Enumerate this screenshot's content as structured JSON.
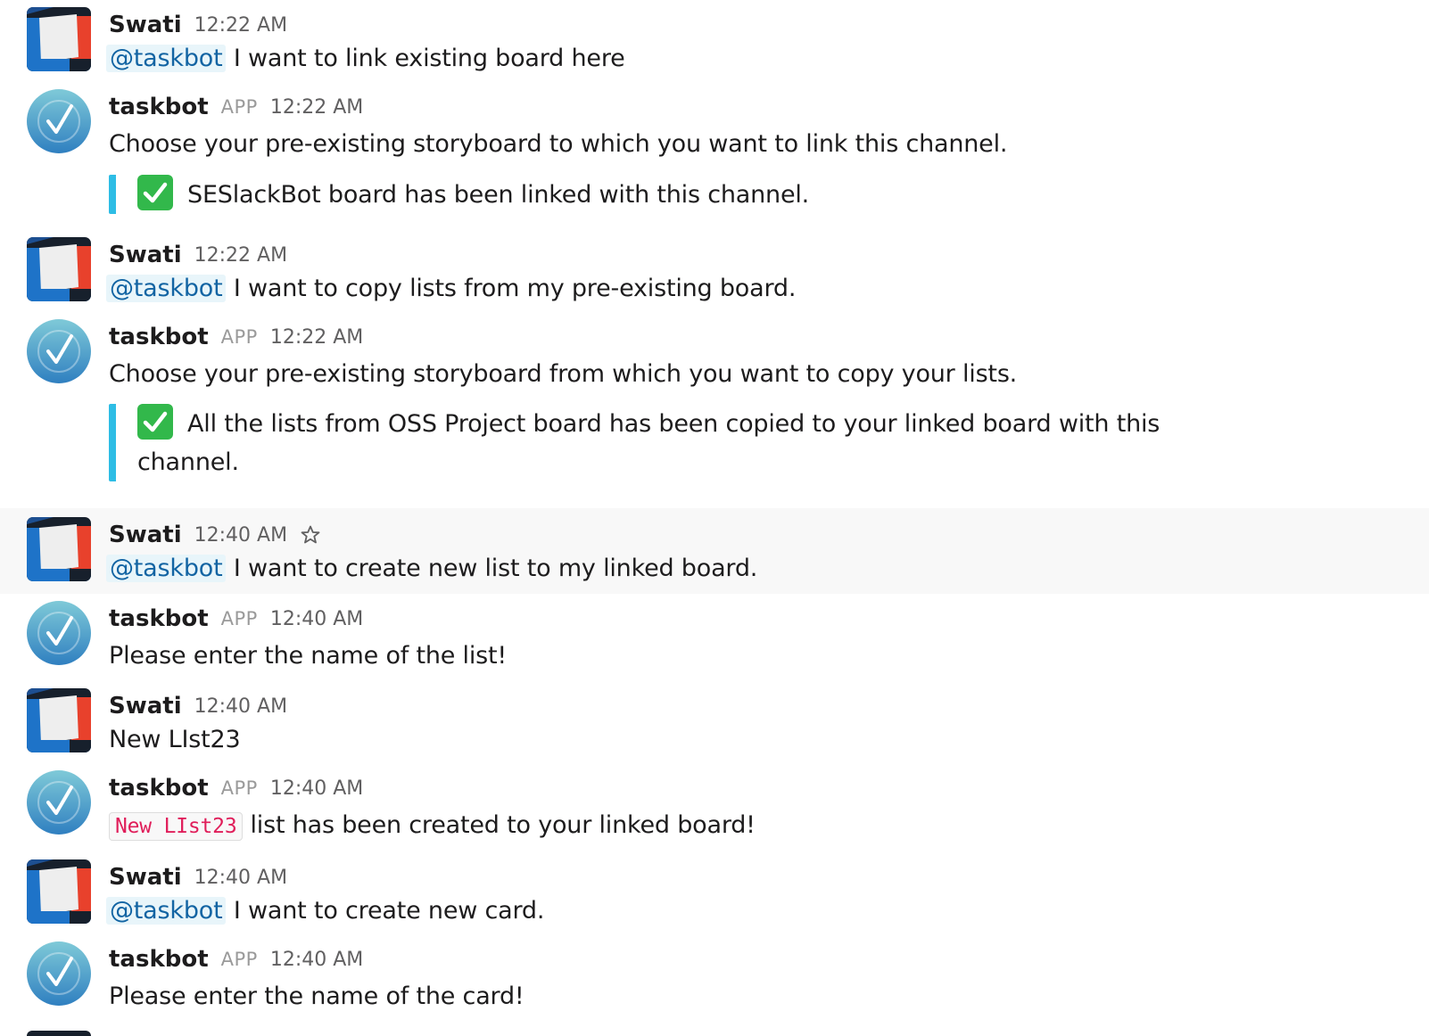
{
  "mention": "@taskbot",
  "app_badge": "APP",
  "messages": [
    {
      "author": "Swati",
      "time": "12:22 AM",
      "body": "I want to link existing board here"
    },
    {
      "author": "taskbot",
      "time": "12:22 AM",
      "body": "Choose your pre-existing storyboard to which you want to link this channel.",
      "attachment": "SESlackBot board has been linked with this channel."
    },
    {
      "author": "Swati",
      "time": "12:22 AM",
      "body": "I want to copy lists from my pre-existing board."
    },
    {
      "author": "taskbot",
      "time": "12:22 AM",
      "body": "Choose your pre-existing storyboard from which you want to copy your lists.",
      "attachment_line1": "All the lists from OSS Project board has been copied to your linked board with this",
      "attachment_line2": "channel."
    },
    {
      "author": "Swati",
      "time": "12:40 AM",
      "body": "I want to create new list to my linked board."
    },
    {
      "author": "taskbot",
      "time": "12:40 AM",
      "body": "Please enter the name of the list!"
    },
    {
      "author": "Swati",
      "time": "12:40 AM",
      "body": "New LIst23"
    },
    {
      "author": "taskbot",
      "time": "12:40 AM",
      "code": "New LIst23",
      "body": "list has been created to your linked board!"
    },
    {
      "author": "Swati",
      "time": "12:40 AM",
      "body": "I want to create new card."
    },
    {
      "author": "taskbot",
      "time": "12:40 AM",
      "body": "Please enter the name of the card!"
    }
  ],
  "colors": {
    "mention": "#1264a3",
    "attachment_bar": "#2ebde5",
    "code_text": "#e01e5a",
    "check": "#32b84b"
  }
}
